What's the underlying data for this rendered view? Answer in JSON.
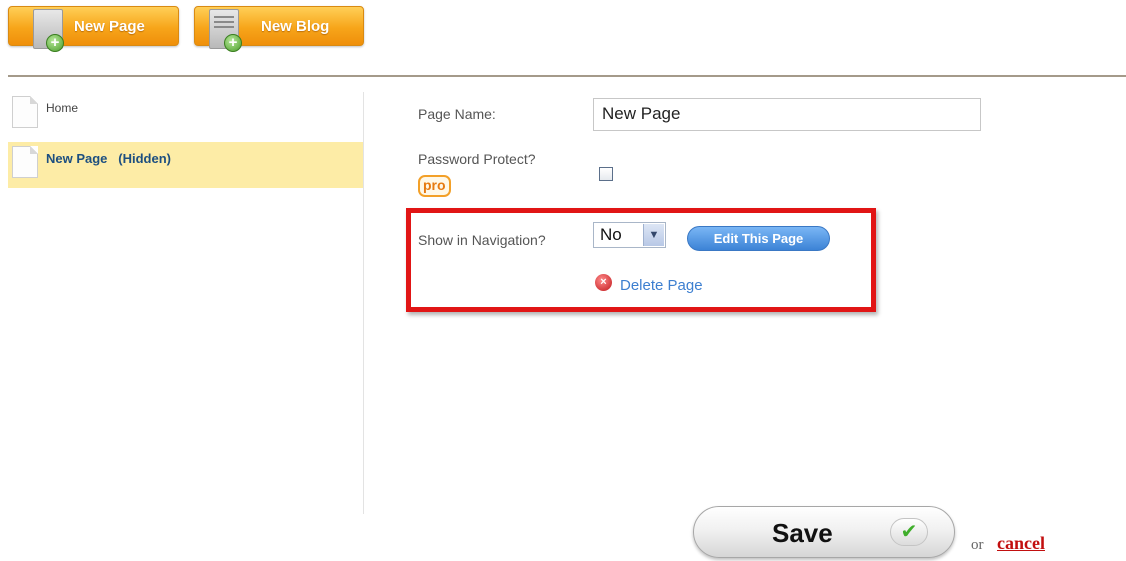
{
  "toolbar": {
    "new_page_label": "New Page",
    "new_blog_label": "New Blog"
  },
  "sidebar": {
    "items": [
      {
        "label": "Home",
        "selected": false
      },
      {
        "label": "New Page   (Hidden)",
        "selected": true
      }
    ]
  },
  "form": {
    "page_name_label": "Page Name:",
    "page_name_value": "New Page",
    "password_protect_label": "Password Protect?",
    "pro_badge": "pro",
    "password_protect_checked": false,
    "show_in_nav_label": "Show in Navigation?",
    "show_in_nav_value": "No",
    "edit_button_label": "Edit This Page",
    "delete_label": "Delete Page"
  },
  "footer": {
    "save_label": "Save",
    "or_text": "or",
    "cancel_label": "cancel"
  },
  "colors": {
    "highlight": "#e11515",
    "selected_row": "#fdeca6",
    "toolbar_button": "#f7a51a",
    "link": "#3d7fd0",
    "cancel": "#c20f0f"
  }
}
